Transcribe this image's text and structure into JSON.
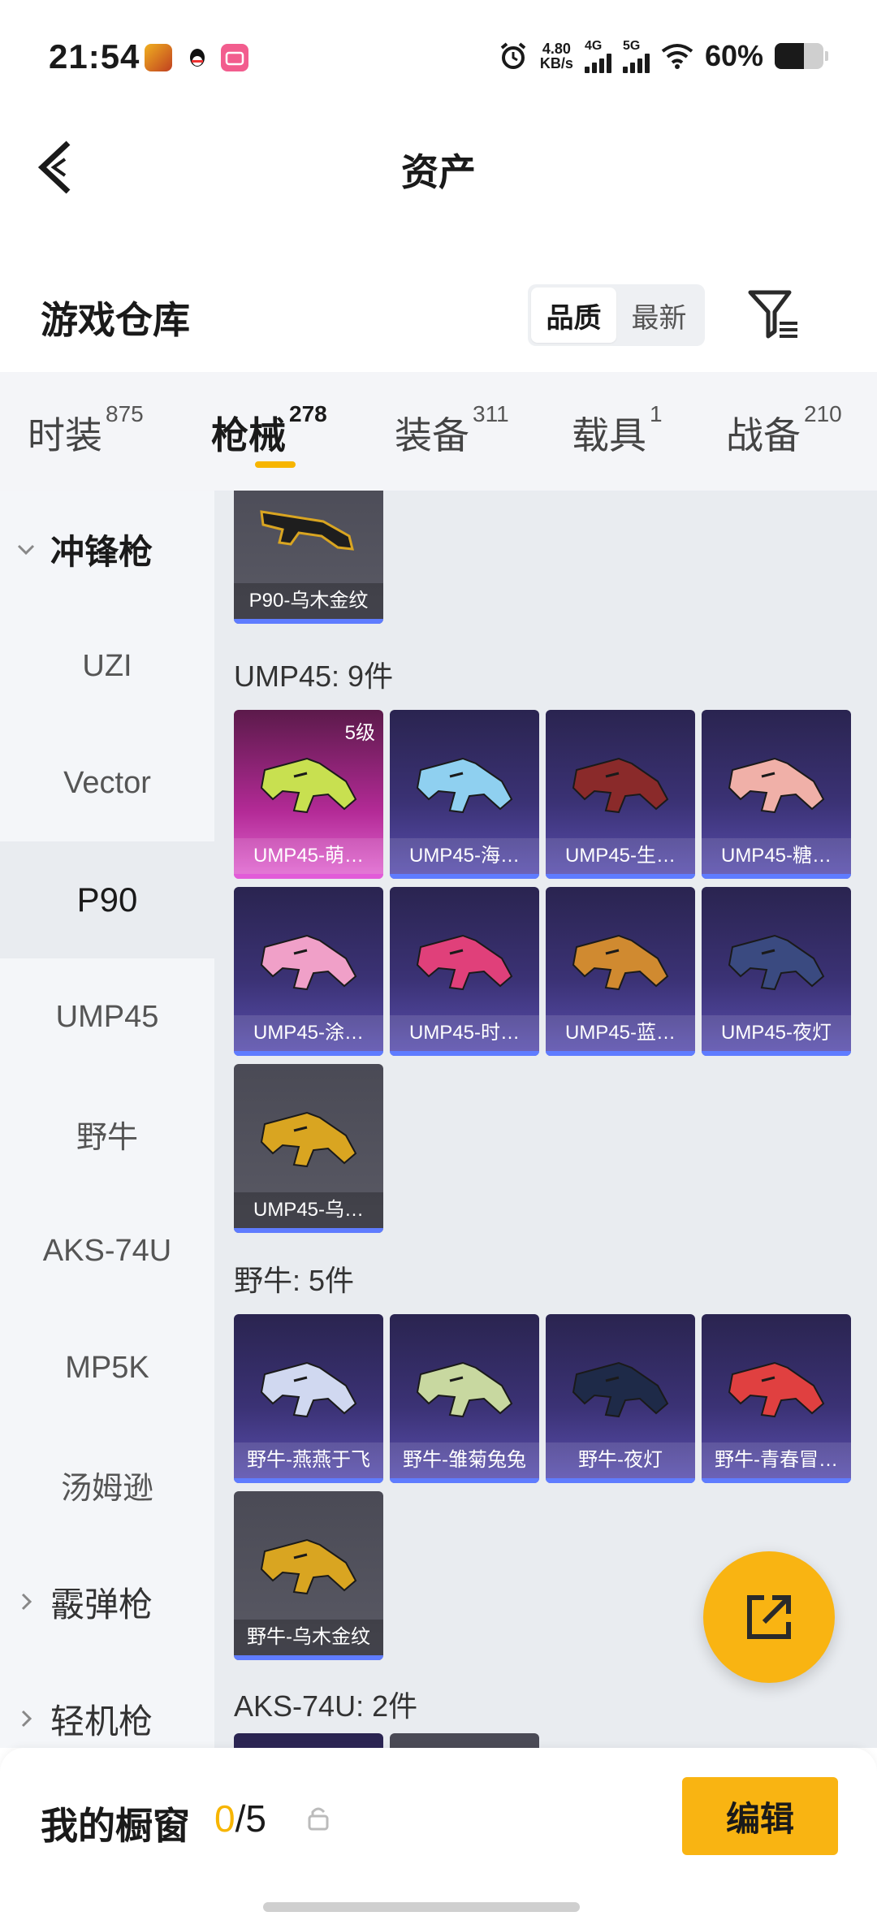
{
  "status": {
    "time": "21:54",
    "speed_value": "4.80",
    "speed_unit": "KB/s",
    "sig1": "4G",
    "sig2": "5G",
    "battery_text": "60%",
    "battery_level": 0.6
  },
  "header": {
    "title": "资产"
  },
  "warehouse": {
    "title": "游戏仓库",
    "sort_options": [
      "品质",
      "最新"
    ],
    "sort_selected": "品质"
  },
  "tabs": [
    {
      "label": "时装",
      "count": "875"
    },
    {
      "label": "枪械",
      "count": "278"
    },
    {
      "label": "装备",
      "count": "311"
    },
    {
      "label": "载具",
      "count": "1"
    },
    {
      "label": "战备",
      "count": "210"
    }
  ],
  "active_tab": "枪械",
  "sidebar": {
    "group_open": "冲锋枪",
    "items": [
      "UZI",
      "Vector",
      "P90",
      "UMP45",
      "野牛",
      "AKS-74U",
      "MP5K",
      "汤姆逊"
    ],
    "active_item": "P90",
    "groups_collapsed": [
      "霰弹枪",
      "轻机枪"
    ]
  },
  "content": {
    "p90_top": {
      "name": "P90-乌木金纹"
    },
    "sections": [
      {
        "title": "UMP45: 9件",
        "items": [
          {
            "name": "UMP45-萌…",
            "style": "pink",
            "level": "5级",
            "color": "#c8e050"
          },
          {
            "name": "UMP45-海…",
            "style": "purple",
            "color": "#8fd0f0"
          },
          {
            "name": "UMP45-生…",
            "style": "purple",
            "color": "#8a2a2a"
          },
          {
            "name": "UMP45-糖…",
            "style": "purple",
            "color": "#f0b0a8"
          },
          {
            "name": "UMP45-涂…",
            "style": "purple",
            "color": "#f0a0c8"
          },
          {
            "name": "UMP45-时…",
            "style": "purple",
            "color": "#e0407a"
          },
          {
            "name": "UMP45-蓝…",
            "style": "purple",
            "color": "#d08a30"
          },
          {
            "name": "UMP45-夜灯",
            "style": "purple",
            "color": "#3a4a80"
          },
          {
            "name": "UMP45-乌…",
            "style": "grey",
            "color": "#d9a521"
          }
        ]
      },
      {
        "title": "野牛: 5件",
        "items": [
          {
            "name": "野牛-燕燕于飞",
            "style": "purple",
            "color": "#d0d8f0"
          },
          {
            "name": "野牛-雏菊兔兔",
            "style": "purple",
            "color": "#c8d8a0"
          },
          {
            "name": "野牛-夜灯",
            "style": "purple",
            "color": "#1e2a48"
          },
          {
            "name": "野牛-青春冒…",
            "style": "purple",
            "color": "#e04040"
          },
          {
            "name": "野牛-乌木金纹",
            "style": "grey",
            "color": "#d9a521"
          }
        ]
      },
      {
        "title": "AKS-74U: 2件",
        "items": []
      }
    ]
  },
  "bottom": {
    "label": "我的橱窗",
    "current": "0",
    "total": "/5",
    "edit": "编辑"
  },
  "colors": {
    "accent": "#f9b412",
    "tab_underline": "#f7b500",
    "card_strip": "#5f7cff"
  }
}
